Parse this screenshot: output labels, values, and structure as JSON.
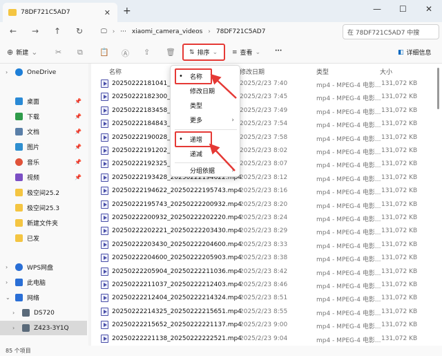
{
  "window": {
    "tab_title": "78DF721C5AD7",
    "tab_close": "✕",
    "new_tab": "+",
    "minimize": "—",
    "maximize": "☐",
    "close": "✕"
  },
  "address": {
    "breadcrumbs": [
      "xiaomi_camera_videos",
      "78DF721C5AD7"
    ],
    "more": "···",
    "search_placeholder": "在 78DF721C5AD7 中搜"
  },
  "toolbar": {
    "new_label": "新建",
    "sort_label": "排序",
    "view_label": "查看",
    "more_label": "···",
    "details_label": "详细信息"
  },
  "sidebar": {
    "items": [
      {
        "label": "OneDrive",
        "icon": "cloud-icon",
        "color": "#1e7fd8"
      },
      {
        "label": "桌面",
        "icon": "desktop-icon",
        "color": "#2a8ad6",
        "pinned": true
      },
      {
        "label": "下载",
        "icon": "download-icon",
        "color": "#2f9b4a",
        "pinned": true
      },
      {
        "label": "文档",
        "icon": "document-icon",
        "color": "#5a7fa8",
        "pinned": true
      },
      {
        "label": "图片",
        "icon": "pictures-icon",
        "color": "#2f8fd0",
        "pinned": true
      },
      {
        "label": "音乐",
        "icon": "music-icon",
        "color": "#e0533a",
        "pinned": true
      },
      {
        "label": "视频",
        "icon": "video-icon",
        "color": "#7b4fc4",
        "pinned": true
      },
      {
        "label": "极空间25.2",
        "icon": "folder-icon",
        "color": "#f4c542"
      },
      {
        "label": "极空间25.3",
        "icon": "folder-icon",
        "color": "#f4c542"
      },
      {
        "label": "新建文件夹",
        "icon": "folder-icon",
        "color": "#f4c542"
      },
      {
        "label": "已发",
        "icon": "folder-icon",
        "color": "#f4c542"
      },
      {
        "label": "WPS网盘",
        "icon": "cloud-icon",
        "color": "#2a6fd6"
      },
      {
        "label": "此电脑",
        "icon": "computer-icon",
        "color": "#2a6fd6"
      },
      {
        "label": "网络",
        "icon": "network-icon",
        "color": "#2a6fd6"
      },
      {
        "label": "DS720",
        "icon": "drive-icon",
        "color": "#5a6a7a"
      },
      {
        "label": "Z423-3Y1Q",
        "icon": "drive-icon",
        "color": "#5a6a7a"
      }
    ]
  },
  "columns": {
    "name": "名称",
    "date": "修改日期",
    "type": "类型",
    "size": "大小"
  },
  "files": [
    {
      "name": "20250222181041_20",
      "date": "2025/2/23 7:40",
      "type": "mp4 - MPEG-4 电影...",
      "size": "131,072 KB"
    },
    {
      "name": "20250222182300_20",
      "date": "2025/2/23 7:45",
      "type": "mp4 - MPEG-4 电影...",
      "size": "131,072 KB"
    },
    {
      "name": "20250222183458_20",
      "date": "2025/2/23 7:49",
      "type": "mp4 - MPEG-4 电影...",
      "size": "131,072 KB"
    },
    {
      "name": "20250222184843_20",
      "date": "2025/2/23 7:54",
      "type": "mp4 - MPEG-4 电影...",
      "size": "131,072 KB"
    },
    {
      "name": "20250222190028_20",
      "date": "2025/2/23 7:58",
      "type": "mp4 - MPEG-4 电影...",
      "size": "131,072 KB"
    },
    {
      "name": "20250222191202_20",
      "date": "2025/2/23 8:02",
      "type": "mp4 - MPEG-4 电影...",
      "size": "131,072 KB"
    },
    {
      "name": "20250222192325_20",
      "date": "2025/2/23 8:07",
      "type": "mp4 - MPEG-4 电影...",
      "size": "131,072 KB"
    },
    {
      "name": "20250222193428_20250222194622.mp4",
      "date": "2025/2/23 8:12",
      "type": "mp4 - MPEG-4 电影...",
      "size": "131,072 KB"
    },
    {
      "name": "20250222194622_20250222195743.mp4",
      "date": "2025/2/23 8:16",
      "type": "mp4 - MPEG-4 电影...",
      "size": "131,072 KB"
    },
    {
      "name": "20250222195743_20250222200932.mp4",
      "date": "2025/2/23 8:20",
      "type": "mp4 - MPEG-4 电影...",
      "size": "131,072 KB"
    },
    {
      "name": "20250222200932_20250222202220.mp4",
      "date": "2025/2/23 8:24",
      "type": "mp4 - MPEG-4 电影...",
      "size": "131,072 KB"
    },
    {
      "name": "20250222202221_20250222203430.mp4",
      "date": "2025/2/23 8:29",
      "type": "mp4 - MPEG-4 电影...",
      "size": "131,072 KB"
    },
    {
      "name": "20250222203430_20250222204600.mp4",
      "date": "2025/2/23 8:33",
      "type": "mp4 - MPEG-4 电影...",
      "size": "131,072 KB"
    },
    {
      "name": "20250222204600_20250222205903.mp4",
      "date": "2025/2/23 8:38",
      "type": "mp4 - MPEG-4 电影...",
      "size": "131,072 KB"
    },
    {
      "name": "20250222205904_20250222211036.mp4",
      "date": "2025/2/23 8:42",
      "type": "mp4 - MPEG-4 电影...",
      "size": "131,072 KB"
    },
    {
      "name": "20250222211037_20250222212403.mp4",
      "date": "2025/2/23 8:46",
      "type": "mp4 - MPEG-4 电影...",
      "size": "131,072 KB"
    },
    {
      "name": "20250222212404_20250222214324.mp4",
      "date": "2025/2/23 8:51",
      "type": "mp4 - MPEG-4 电影...",
      "size": "131,072 KB"
    },
    {
      "name": "20250222214325_20250222215651.mp4",
      "date": "2025/2/23 8:55",
      "type": "mp4 - MPEG-4 电影...",
      "size": "131,072 KB"
    },
    {
      "name": "20250222215652_20250222221137.mp4",
      "date": "2025/2/23 9:00",
      "type": "mp4 - MPEG-4 电影...",
      "size": "131,072 KB"
    },
    {
      "name": "20250222221138_20250222222521.mp4",
      "date": "2025/2/23 9:04",
      "type": "mp4 - MPEG-4 电影...",
      "size": "131,072 KB"
    }
  ],
  "sort_menu": {
    "by_name": "名称",
    "by_date": "修改日期",
    "by_type": "类型",
    "more": "更多",
    "ascending": "递增",
    "descending": "递减",
    "group_by": "分组依据"
  },
  "status": {
    "item_count": "85 个项目"
  },
  "colors": {
    "highlight": "#e53935",
    "accent": "#0067c0"
  }
}
